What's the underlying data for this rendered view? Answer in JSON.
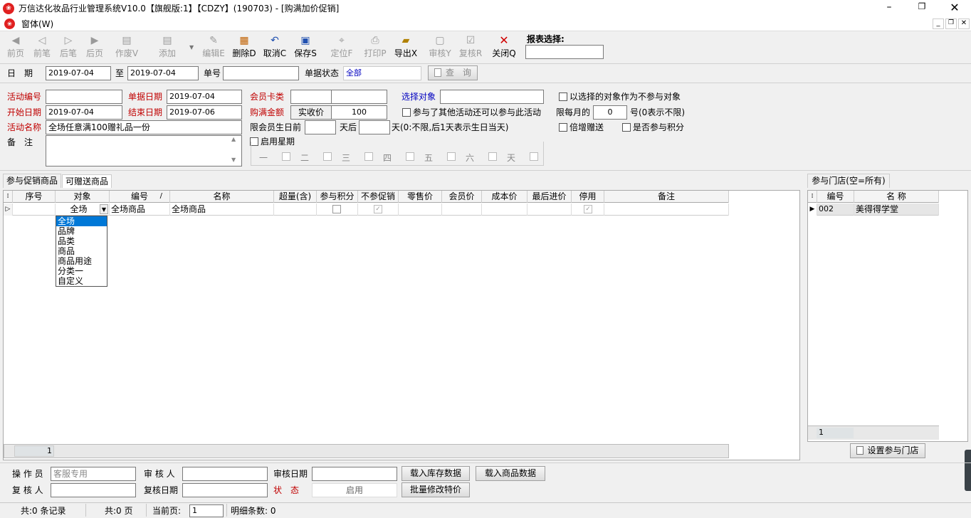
{
  "window": {
    "title": "万信达化妆品行业管理系统V10.0【旗舰版:1】【CDZY】(190703) - [购满加价促销]",
    "menu_label": "窗体(W)"
  },
  "toolbar": {
    "buttons": [
      {
        "label": "前页",
        "icon": "first-page-icon",
        "enabled": false
      },
      {
        "label": "前笔",
        "icon": "prev-record-icon",
        "enabled": false
      },
      {
        "label": "后笔",
        "icon": "next-record-icon",
        "enabled": false
      },
      {
        "label": "后页",
        "icon": "last-page-icon",
        "enabled": false
      },
      {
        "label": "作废V",
        "icon": "void-icon",
        "enabled": false
      },
      {
        "label": "添加",
        "icon": "add-icon",
        "enabled": false
      },
      {
        "label": "编辑E",
        "icon": "edit-icon",
        "enabled": false
      },
      {
        "label": "删除D",
        "icon": "delete-icon",
        "enabled": true
      },
      {
        "label": "取消C",
        "icon": "undo-icon",
        "enabled": true
      },
      {
        "label": "保存S",
        "icon": "save-icon",
        "enabled": true
      },
      {
        "label": "定位F",
        "icon": "locate-icon",
        "enabled": false
      },
      {
        "label": "打印P",
        "icon": "print-icon",
        "enabled": false
      },
      {
        "label": "导出X",
        "icon": "export-icon",
        "enabled": true
      },
      {
        "label": "审核Y",
        "icon": "audit-icon",
        "enabled": false
      },
      {
        "label": "复核R",
        "icon": "recheck-icon",
        "enabled": false
      },
      {
        "label": "关闭Q",
        "icon": "close-icon",
        "enabled": true
      }
    ],
    "report_select_label": "报表选择:",
    "report_select_value": ""
  },
  "filter": {
    "date_label": "日　期",
    "date_from": "2019-07-04",
    "to_label": "至",
    "date_to": "2019-07-04",
    "doc_no_label": "单号",
    "doc_no": "",
    "status_label": "单据状态",
    "status_value": "全部",
    "query_button": "查　询"
  },
  "form": {
    "activity_no_label": "活动编号",
    "activity_no": "",
    "doc_date_label": "单据日期",
    "doc_date": "2019-07-04",
    "member_card_label": "会员卡类",
    "member_card_1": "",
    "member_card_2": "",
    "select_target_label": "选择对象",
    "select_target": "",
    "exclude_target_label": "以选择的对象作为不参与对象",
    "start_date_label": "开始日期",
    "start_date": "2019-07-04",
    "end_date_label": "结束日期",
    "end_date": "2019-07-06",
    "full_amount_label": "购满金额",
    "paid_price_label": "实收价",
    "paid_price": "100",
    "joined_other_label": "参与了其他活动还可以参与此活动",
    "monthly_limit_label": "限每月的",
    "monthly_day": "0",
    "monthly_note": "号(0表示不限)",
    "activity_name_label": "活动名称",
    "activity_name": "全场任意满100赠礼品一份",
    "birthday_before_label": "限会员生日前",
    "birthday_before": "",
    "days_after_label": "天后",
    "birthday_after": "",
    "birthday_note": "天(0:不限,后1天表示生日当天)",
    "double_gift_label": "倍增赠送",
    "join_points_label": "是否参与积分",
    "remark_label": "备　注",
    "remark": "",
    "weekday_enable_label": "启用星期",
    "weekdays": [
      "一",
      "二",
      "三",
      "四",
      "五",
      "六",
      "天"
    ]
  },
  "tabs": {
    "left": [
      "参与促销商品",
      "可赠送商品"
    ],
    "right": "参与门店(空=所有)"
  },
  "product_grid": {
    "columns": [
      "序号",
      "对象",
      "编号",
      "名称",
      "超量(含)",
      "参与积分",
      "不参促销",
      "零售价",
      "会员价",
      "成本价",
      "最后进价",
      "停用",
      "备注"
    ],
    "sort_marker": "/",
    "rows": [
      {
        "object": "全场",
        "code": "全场商品",
        "name": "全场商品",
        "join_points": false,
        "no_promo": true,
        "disabled": true
      }
    ],
    "dropdown_options": [
      "全场",
      "品牌",
      "品类",
      "商品",
      "商品用途",
      "分类一",
      "自定义"
    ],
    "footer_count": "1"
  },
  "store_grid": {
    "columns": [
      "编号",
      "名 称"
    ],
    "rows": [
      {
        "code": "002",
        "name": "美得得学堂"
      }
    ],
    "footer_count": "1",
    "set_store_button": "设置参与门店"
  },
  "bottom": {
    "operator_label": "操 作 员",
    "operator": "客服专用",
    "auditor_label": "审 核 人",
    "auditor": "",
    "audit_date_label": "审核日期",
    "audit_date": "",
    "load_stock_button": "载入库存数据",
    "load_goods_button": "载入商品数据",
    "rechecker_label": "复 核 人",
    "rechecker": "",
    "recheck_date_label": "复核日期",
    "recheck_date": "",
    "status_label": "状　态",
    "status_value": "启用",
    "batch_price_button": "批量修改特价"
  },
  "statusbar": {
    "records": "共:0 条记录",
    "pages": "共:0 页",
    "current_page_label": "当前页:",
    "current_page": "1",
    "detail_count": "明细条数: 0"
  }
}
